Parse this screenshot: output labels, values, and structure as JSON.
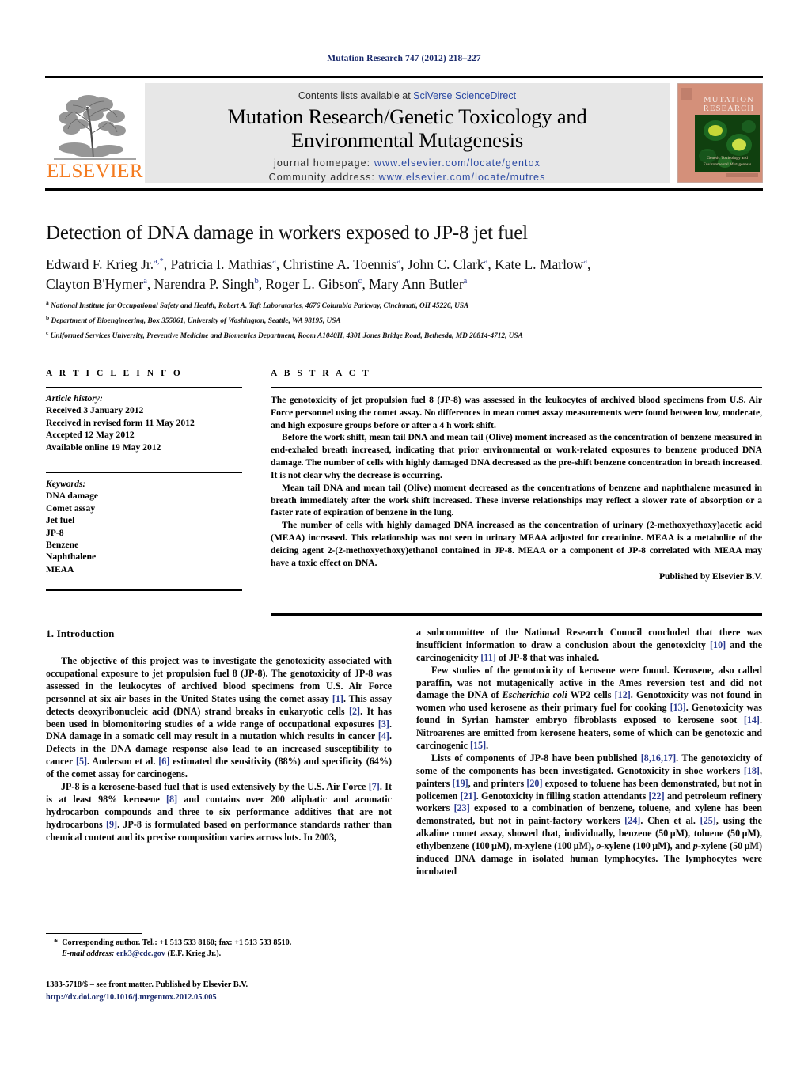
{
  "running_head": "Mutation Research 747 (2012) 218–227",
  "masthead": {
    "contents_prefix": "Contents lists available at ",
    "contents_link": "SciVerse ScienceDirect",
    "journal_title_line1": "Mutation Research/Genetic Toxicology and",
    "journal_title_line2": "Environmental Mutagenesis",
    "homepage_label": "journal homepage: ",
    "homepage_url": "www.elsevier.com/locate/gentox",
    "community_label": "Community address: ",
    "community_url": "www.elsevier.com/locate/mutres",
    "publisher_name": "ELSEVIER",
    "cover": {
      "title_line1": "MUTATION",
      "title_line2": "RESEARCH",
      "subtitle_line1": "Genetic Toxicology and",
      "subtitle_line2": "Environmental Mutagenesis"
    }
  },
  "article": {
    "title": "Detection of DNA damage in workers exposed to JP-8 jet fuel",
    "authors_line1": "Edward F. Krieg Jr.",
    "authors_line1_rest": ", Patricia I. Mathias",
    "authors_full": "Edward F. Krieg Jr.a,*, Patricia I. Mathiasa, Christine A. Toennisa, John C. Clarka, Kate L. Marlowa, Clayton B'Hymera, Narendra P. Singhb, Roger L. Gibsonc, Mary Ann Butlera",
    "affiliations": [
      "National Institute for Occupational Safety and Health, Robert A. Taft Laboratories, 4676 Columbia Parkway, Cincinnati, OH 45226, USA",
      "Department of Bioengineering, Box 355061, University of Washington, Seattle, WA 98195, USA",
      "Uniformed Services University, Preventive Medicine and Biometrics Department, Room A1040H, 4301 Jones Bridge Road, Bethesda, MD 20814-4712, USA"
    ],
    "affiliation_marks": [
      "a",
      "b",
      "c"
    ]
  },
  "article_info": {
    "heading": "A R T I C L E   I N F O",
    "history_label": "Article history:",
    "history": [
      "Received 3 January 2012",
      "Received in revised form 11 May 2012",
      "Accepted 12 May 2012",
      "Available online 19 May 2012"
    ],
    "keywords_label": "Keywords:",
    "keywords": [
      "DNA damage",
      "Comet assay",
      "Jet fuel",
      "JP-8",
      "Benzene",
      "Naphthalene",
      "MEAA"
    ]
  },
  "abstract": {
    "heading": "A B S T R A C T",
    "paragraphs": [
      "The genotoxicity of jet propulsion fuel 8 (JP-8) was assessed in the leukocytes of archived blood specimens from U.S. Air Force personnel using the comet assay. No differences in mean comet assay measurements were found between low, moderate, and high exposure groups before or after a 4 h work shift.",
      "Before the work shift, mean tail DNA and mean tail (Olive) moment increased as the concentration of benzene measured in end-exhaled breath increased, indicating that prior environmental or work-related exposures to benzene produced DNA damage. The number of cells with highly damaged DNA decreased as the pre-shift benzene concentration in breath increased. It is not clear why the decrease is occurring.",
      "Mean tail DNA and mean tail (Olive) moment decreased as the concentrations of benzene and naphthalene measured in breath immediately after the work shift increased. These inverse relationships may reflect a slower rate of absorption or a faster rate of expiration of benzene in the lung.",
      "The number of cells with highly damaged DNA increased as the concentration of urinary (2-methoxyethoxy)acetic acid (MEAA) increased. This relationship was not seen in urinary MEAA adjusted for creatinine. MEAA is a metabolite of the deicing agent 2-(2-methoxyethoxy)ethanol contained in JP-8. MEAA or a component of JP-8 correlated with MEAA may have a toxic effect on DNA."
    ],
    "credit": "Published by Elsevier B.V."
  },
  "body": {
    "section_number_title": "1.  Introduction",
    "left_column": [
      "The objective of this project was to investigate the genotoxicity associated with occupational exposure to jet propulsion fuel 8 (JP-8). The genotoxicity of JP-8 was assessed in the leukocytes of archived blood specimens from U.S. Air Force personnel at six air bases in the United States using the comet assay [1]. This assay detects deoxyribonucleic acid (DNA) strand breaks in eukaryotic cells [2]. It has been used in biomonitoring studies of a wide range of occupational exposures [3]. DNA damage in a somatic cell may result in a mutation which results in cancer [4]. Defects in the DNA damage response also lead to an increased susceptibility to cancer [5]. Anderson et al. [6] estimated the sensitivity (88%) and specificity (64%) of the comet assay for carcinogens.",
      "JP-8 is a kerosene-based fuel that is used extensively by the U.S. Air Force [7]. It is at least 98% kerosene [8] and contains over 200 aliphatic and aromatic hydrocarbon compounds and three to six performance additives that are not hydrocarbons [9]. JP-8 is formulated based on performance standards rather than chemical content and its precise composition varies across lots. In 2003,"
    ],
    "right_column": [
      "a subcommittee of the National Research Council concluded that there was insufficient information to draw a conclusion about the genotoxicity [10] and the carcinogenicity [11] of JP-8 that was inhaled.",
      "Few studies of the genotoxicity of kerosene were found. Kerosene, also called paraffin, was not mutagenically active in the Ames reversion test and did not damage the DNA of Escherichia coli WP2 cells [12]. Genotoxicity was not found in women who used kerosene as their primary fuel for cooking [13]. Genotoxicity was found in Syrian hamster embryo fibroblasts exposed to kerosene soot [14]. Nitroarenes are emitted from kerosene heaters, some of which can be genotoxic and carcinogenic [15].",
      "Lists of components of JP-8 have been published [8,16,17]. The genotoxicity of some of the components has been investigated. Genotoxicity in shoe workers [18], painters [19], and printers [20] exposed to toluene has been demonstrated, but not in policemen [21]. Genotoxicity in filling station attendants [22] and petroleum refinery workers [23] exposed to a combination of benzene, toluene, and xylene has been demonstrated, but not in paint-factory workers [24]. Chen et al. [25], using the alkaline comet assay, showed that, individually, benzene (50 μM), toluene (50 μM), ethylbenzene (100 μM), m-xylene (100 μM), o-xylene (100 μM), and p-xylene (50 μM) induced DNA damage in isolated human lymphocytes. The lymphocytes were incubated"
    ]
  },
  "footnote": {
    "corresponding": "Corresponding author. Tel.: +1 513 533 8160; fax: +1 513 533 8510.",
    "email_label": "E-mail address:",
    "email": "erk3@cdc.gov",
    "email_owner": "(E.F. Krieg Jr.)."
  },
  "imprint": {
    "front_matter": "1383-5718/$ – see front matter. Published by Elsevier B.V.",
    "doi": "http://dx.doi.org/10.1016/j.mrgentox.2012.05.005"
  },
  "colors": {
    "link_blue": "#2b49a3",
    "ref_blue": "#2b3a8f",
    "running_head_blue": "#1a2a6c",
    "elsevier_orange": "#F47B20",
    "band_gray": "#e7e7e7",
    "cover_salmon": "#d4907a"
  }
}
